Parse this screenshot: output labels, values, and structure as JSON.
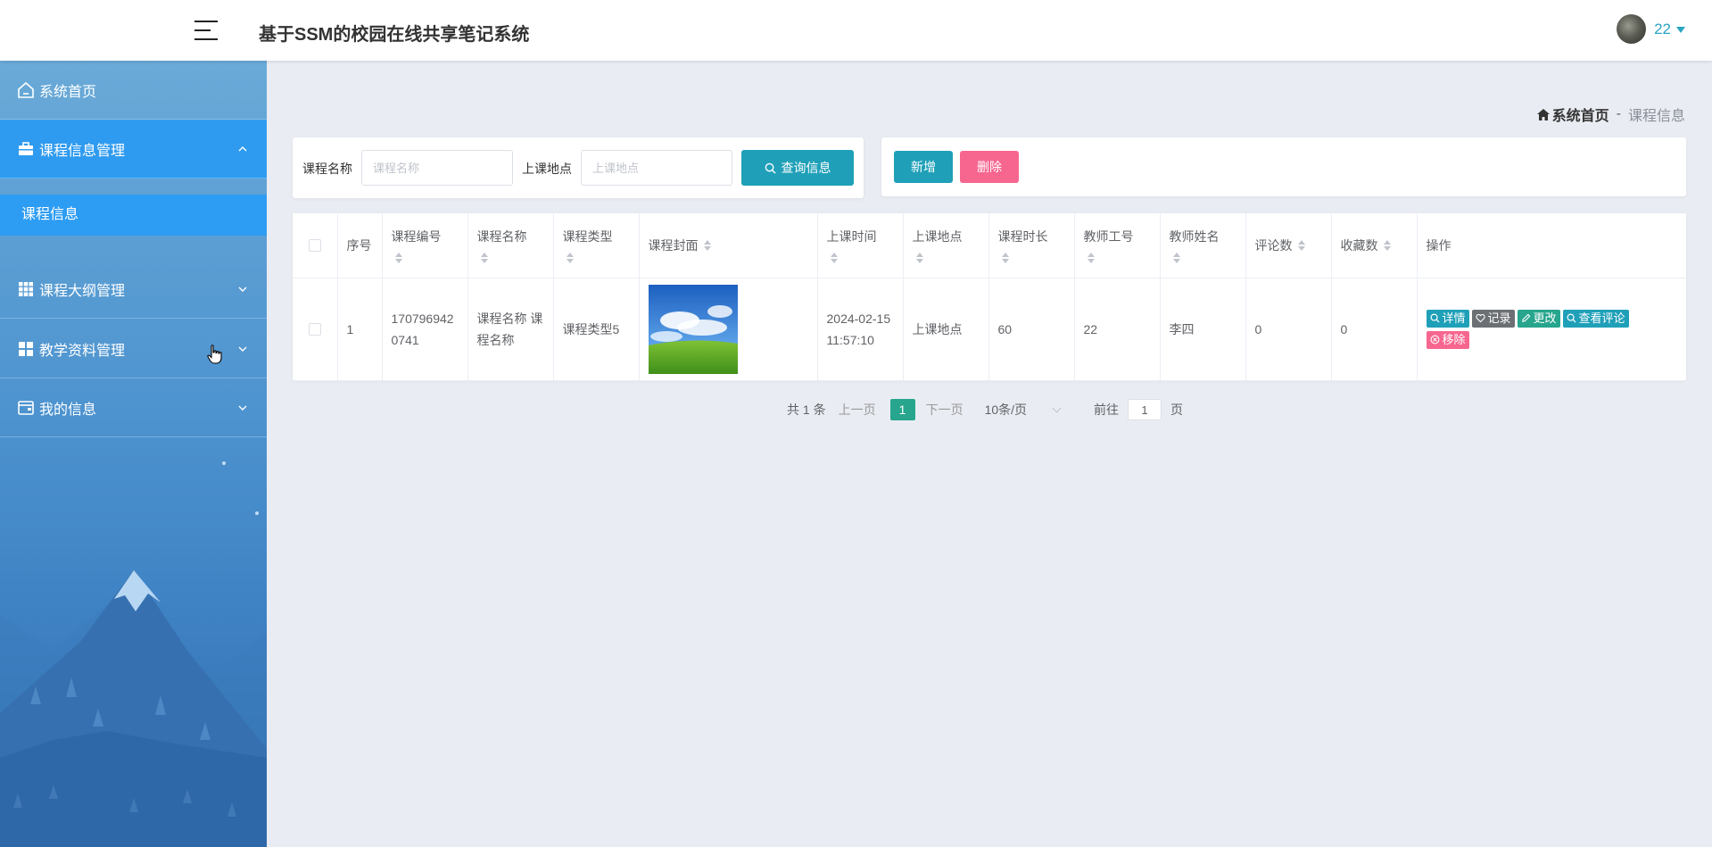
{
  "header": {
    "app_title": "基于SSM的校园在线共享笔记系统",
    "user_name": "22"
  },
  "sidebar": {
    "items": [
      {
        "label": "系统首页",
        "icon": "home-icon"
      },
      {
        "label": "课程信息管理",
        "icon": "briefcase-icon",
        "expanded": true,
        "children": [
          {
            "label": "课程信息",
            "active": true
          }
        ]
      },
      {
        "label": "课程大纲管理",
        "icon": "grid-icon"
      },
      {
        "label": "教学资料管理",
        "icon": "apps-icon"
      },
      {
        "label": "我的信息",
        "icon": "wallet-icon"
      }
    ]
  },
  "breadcrumb": {
    "home": "系统首页",
    "separator": "-",
    "current": "课程信息"
  },
  "search": {
    "course_name_label": "课程名称",
    "course_name_placeholder": "课程名称",
    "location_label": "上课地点",
    "location_placeholder": "上课地点",
    "search_button": "查询信息"
  },
  "actions": {
    "add": "新增",
    "delete": "删除"
  },
  "table": {
    "headers": {
      "index": "序号",
      "course_code": "课程编号",
      "course_name": "课程名称",
      "course_type": "课程类型",
      "cover": "课程封面",
      "class_time": "上课时间",
      "location": "上课地点",
      "duration": "课程时长",
      "teacher_id": "教师工号",
      "teacher_name": "教师姓名",
      "comments": "评论数",
      "favorites": "收藏数",
      "ops": "操作"
    },
    "rows": [
      {
        "index": "1",
        "course_code": "1707969420741",
        "course_name": "课程名称 课程名称",
        "course_type": "课程类型5",
        "class_time": "2024-02-15 11:57:10",
        "location": "上课地点",
        "duration": "60",
        "teacher_id": "22",
        "teacher_name": "李四",
        "comments": "0",
        "favorites": "0"
      }
    ],
    "row_actions": {
      "detail": "详情",
      "record": "记录",
      "edit": "更改",
      "view_comments": "查看评论",
      "remove": "移除"
    }
  },
  "pagination": {
    "total": "共 1 条",
    "prev": "上一页",
    "current_page": "1",
    "next": "下一页",
    "page_size": "10条/页",
    "goto_label": "前往",
    "goto_value": "1",
    "page_suffix": "页"
  },
  "colors": {
    "primary": "#1fa0b8",
    "danger": "#f7668f",
    "success": "#27a58d",
    "sidebar_active": "#2f9bf0"
  }
}
